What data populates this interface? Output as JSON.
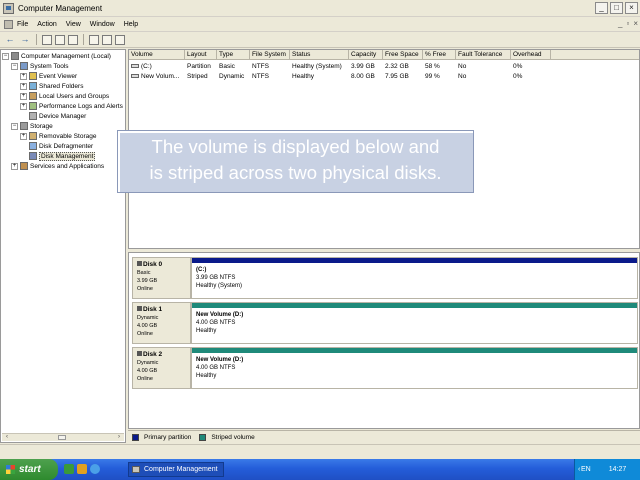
{
  "window": {
    "title": "Computer Management"
  },
  "menu": [
    "File",
    "Action",
    "View",
    "Window",
    "Help"
  ],
  "tree": [
    {
      "label": "Computer Management (Local)",
      "level": 0,
      "expander": "−"
    },
    {
      "label": "System Tools",
      "level": 1,
      "expander": "−"
    },
    {
      "label": "Event Viewer",
      "level": 2,
      "expander": "+"
    },
    {
      "label": "Shared Folders",
      "level": 2,
      "expander": "+"
    },
    {
      "label": "Local Users and Groups",
      "level": 2,
      "expander": "+"
    },
    {
      "label": "Performance Logs and Alerts",
      "level": 2,
      "expander": "+"
    },
    {
      "label": "Device Manager",
      "level": 2,
      "expander": ""
    },
    {
      "label": "Storage",
      "level": 1,
      "expander": "−"
    },
    {
      "label": "Removable Storage",
      "level": 2,
      "expander": "+"
    },
    {
      "label": "Disk Defragmenter",
      "level": 2,
      "expander": ""
    },
    {
      "label": "Disk Management",
      "level": 2,
      "expander": "",
      "selected": true
    },
    {
      "label": "Services and Applications",
      "level": 1,
      "expander": "+"
    }
  ],
  "volume_list": {
    "columns": [
      "Volume",
      "Layout",
      "Type",
      "File System",
      "Status",
      "Capacity",
      "Free Space",
      "% Free",
      "Fault Tolerance",
      "Overhead"
    ],
    "rows": [
      [
        "(C:)",
        "Partition",
        "Basic",
        "NTFS",
        "Healthy (System)",
        "3.99 GB",
        "2.32 GB",
        "58 %",
        "No",
        "0%"
      ],
      [
        "New Volum...",
        "Striped",
        "Dynamic",
        "NTFS",
        "Healthy",
        "8.00 GB",
        "7.95 GB",
        "99 %",
        "No",
        "0%"
      ]
    ]
  },
  "callout": {
    "line1": "The volume is displayed below and",
    "line2": "is striped across two physical disks."
  },
  "disks": [
    {
      "name": "Disk 0",
      "type": "Basic",
      "size": "3.99 GB",
      "status": "Online",
      "volume": {
        "name": "(C:)",
        "detail": "3.99 GB NTFS",
        "health": "Healthy (System)",
        "bar_color": "#0a1a8a"
      }
    },
    {
      "name": "Disk 1",
      "type": "Dynamic",
      "size": "4.00 GB",
      "status": "Online",
      "volume": {
        "name": "New Volume  (D:)",
        "detail": "4.00 GB NTFS",
        "health": "Healthy",
        "bar_color": "#1f8a7a"
      }
    },
    {
      "name": "Disk 2",
      "type": "Dynamic",
      "size": "4.00 GB",
      "status": "Online",
      "volume": {
        "name": "New Volume  (D:)",
        "detail": "4.00 GB NTFS",
        "health": "Healthy",
        "bar_color": "#1f8a7a"
      }
    }
  ],
  "legend": [
    {
      "label": "Primary partition",
      "color": "#0a1a8a"
    },
    {
      "label": "Striped volume",
      "color": "#1f8a7a"
    }
  ],
  "taskbar": {
    "start": "start",
    "task": "Computer Management",
    "language": "EN",
    "clock": "14:27"
  }
}
